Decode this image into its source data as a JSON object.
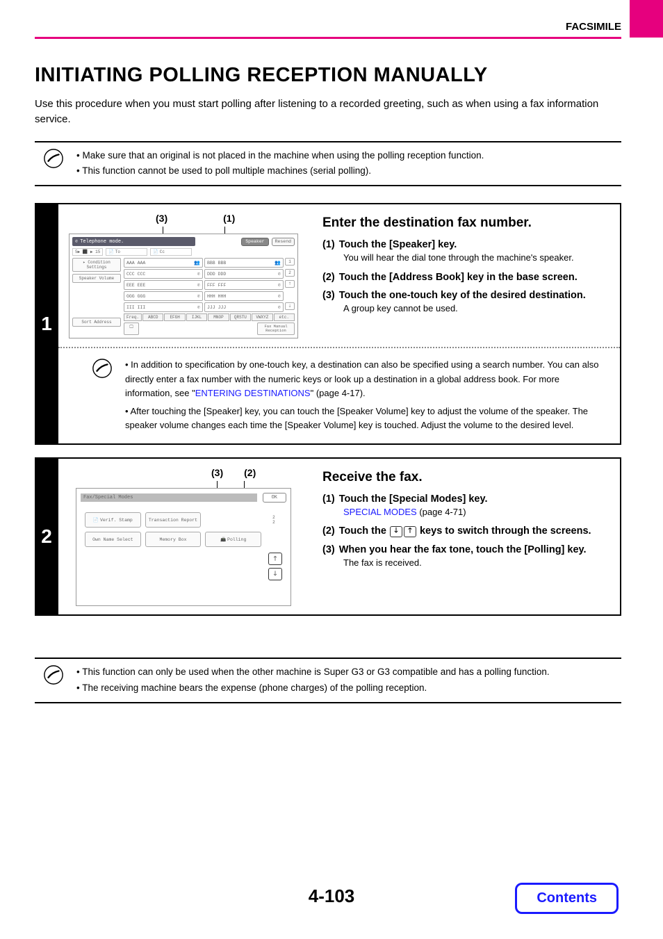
{
  "header": {
    "section": "FACSIMILE"
  },
  "title": "INITIATING POLLING RECEPTION MANUALLY",
  "intro": "Use this procedure when you must start polling after listening to a recorded greeting, such as when using a fax information service.",
  "top_notes": [
    "Make sure that an original is not placed in the machine when using the polling reception function.",
    "This function cannot be used to poll multiple machines (serial polling)."
  ],
  "step1": {
    "num": "1",
    "callouts": [
      "(3)",
      "(1)"
    ],
    "screen": {
      "mode": "Telephone mode.",
      "speaker_btn": "Speaker",
      "resend_btn": "Resend",
      "to_label": "To",
      "cc_label": "Cc",
      "left_buttons": [
        "Condition Settings",
        "Speaker Volume",
        "Sort Address"
      ],
      "contacts_l": [
        "AAA AAA",
        "CCC CCC",
        "EEE EEE",
        "GGG GGG",
        "III III"
      ],
      "contacts_r": [
        "BBB BBB",
        "DDD DDD",
        "FFF FFF",
        "HHH HHH",
        "JJJ JJJ"
      ],
      "page_indicator_1": "1",
      "page_indicator_2": "2",
      "freq_label": "Freq.",
      "tabs": [
        "ABCD",
        "EFGH",
        "IJKL",
        "MNOP",
        "QRSTU",
        "VWXYZ",
        "etc."
      ],
      "bottom_right": "Fax Manual Reception",
      "five_play": "5▶ ⬛ ▶ 15"
    },
    "heading": "Enter the destination fax number.",
    "items": [
      {
        "label": "(1)",
        "text": "Touch the [Speaker] key.",
        "sub": "You will hear the dial tone through the machine's speaker."
      },
      {
        "label": "(2)",
        "text": "Touch the [Address Book] key in the base screen.",
        "sub": ""
      },
      {
        "label": "(3)",
        "text": "Touch the one-touch key of the desired destination.",
        "sub": "A group key cannot be used."
      }
    ],
    "inner_notes": {
      "n1a": "In addition to specification by one-touch key, a destination can also be specified using a search number. You can also directly enter a fax number with the numeric keys or look up a destination in a global address book. For more information, see \"",
      "n1link": "ENTERING DESTINATIONS",
      "n1b": "\" (page 4-17).",
      "n2": "After touching the [Speaker] key, you can touch the [Speaker Volume] key to adjust the volume of the speaker. The speaker volume changes each time the [Speaker Volume] key is touched. Adjust the volume to the desired level."
    }
  },
  "step2": {
    "num": "2",
    "callouts": [
      "(3)",
      "(2)"
    ],
    "screen": {
      "title": "Fax/Special Modes",
      "ok": "OK",
      "buttons": [
        "Verif. Stamp",
        "Transaction Report",
        "Own Name Select",
        "Memory Box",
        "Polling"
      ],
      "pager_top": "2",
      "pager_bottom": "2"
    },
    "heading": "Receive the fax.",
    "items": {
      "i1_label": "(1)",
      "i1_text": "Touch the [Special Modes] key.",
      "i1_link": "SPECIAL MODES",
      "i1_link_after": " (page 4-71)",
      "i2_label": "(2)",
      "i2_text_a": "Touch the ",
      "i2_text_b": " keys to switch through the screens.",
      "i3_label": "(3)",
      "i3_text": "When you hear the fax tone, touch the [Polling] key.",
      "i3_sub": "The fax is received."
    }
  },
  "bottom_notes": [
    "This function can only be used when the other machine is Super G3 or G3 compatible and has a polling function.",
    "The receiving machine bears the expense (phone charges) of the polling reception."
  ],
  "page_num": "4-103",
  "contents_btn": "Contents"
}
